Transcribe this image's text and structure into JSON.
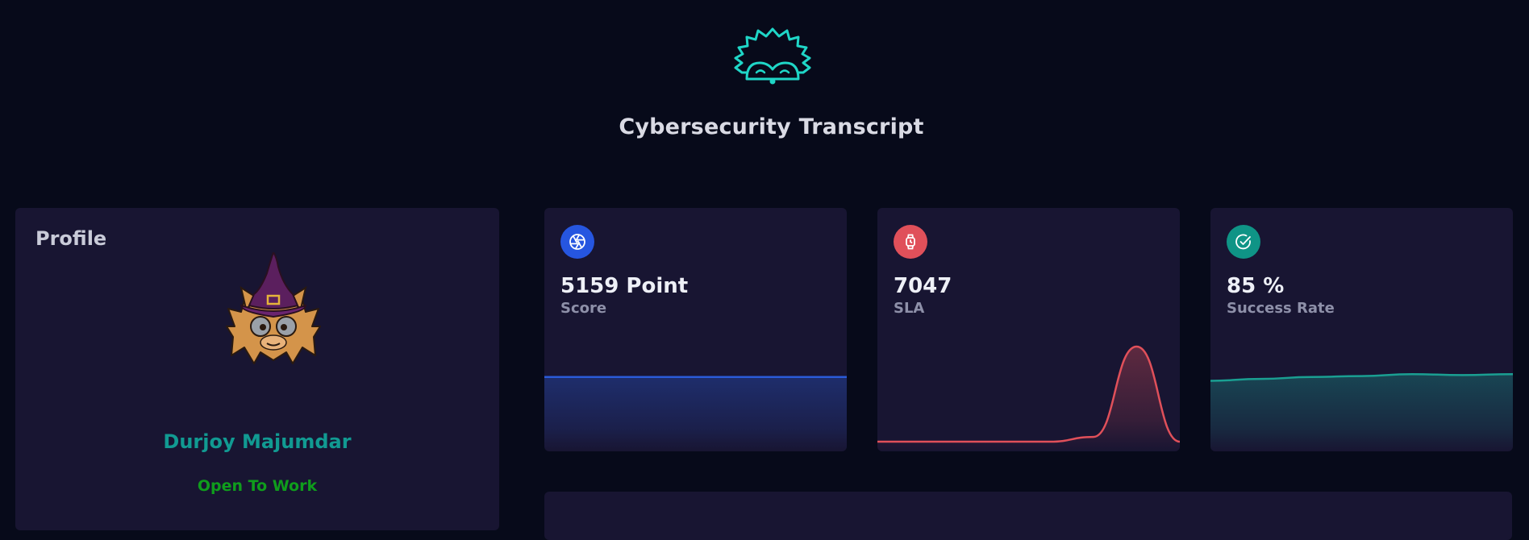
{
  "header": {
    "title": "Cybersecurity Transcript",
    "logo_icon": "hedgehog-logo-icon"
  },
  "profile": {
    "heading": "Profile",
    "avatar_icon": "witch-hat-character-avatar",
    "name": "Durjoy Majumdar",
    "status": "Open To Work"
  },
  "stats": [
    {
      "icon": "aperture-icon",
      "icon_color": "#2656e0",
      "value": "5159 Point",
      "label": "Score",
      "line_color": "#2a5bd8",
      "trend": [
        0.68,
        0.68,
        0.68,
        0.68,
        0.68,
        0.68,
        0.68
      ]
    },
    {
      "icon": "watch-icon",
      "icon_color": "#e0505a",
      "value": "7047",
      "label": "SLA",
      "line_color": "#e0505a",
      "trend": [
        0.0,
        0.0,
        0.0,
        0.0,
        0.0,
        0.05,
        1.0,
        0.0
      ]
    },
    {
      "icon": "check-circle-icon",
      "icon_color": "#0f9486",
      "value": "85 %",
      "label": "Success Rate",
      "line_color": "#1a9f92",
      "trend": [
        0.64,
        0.66,
        0.68,
        0.69,
        0.71,
        0.7,
        0.71
      ]
    }
  ],
  "colors": {
    "background": "#070a1a",
    "card": "#181532",
    "accent": "#119a92"
  }
}
